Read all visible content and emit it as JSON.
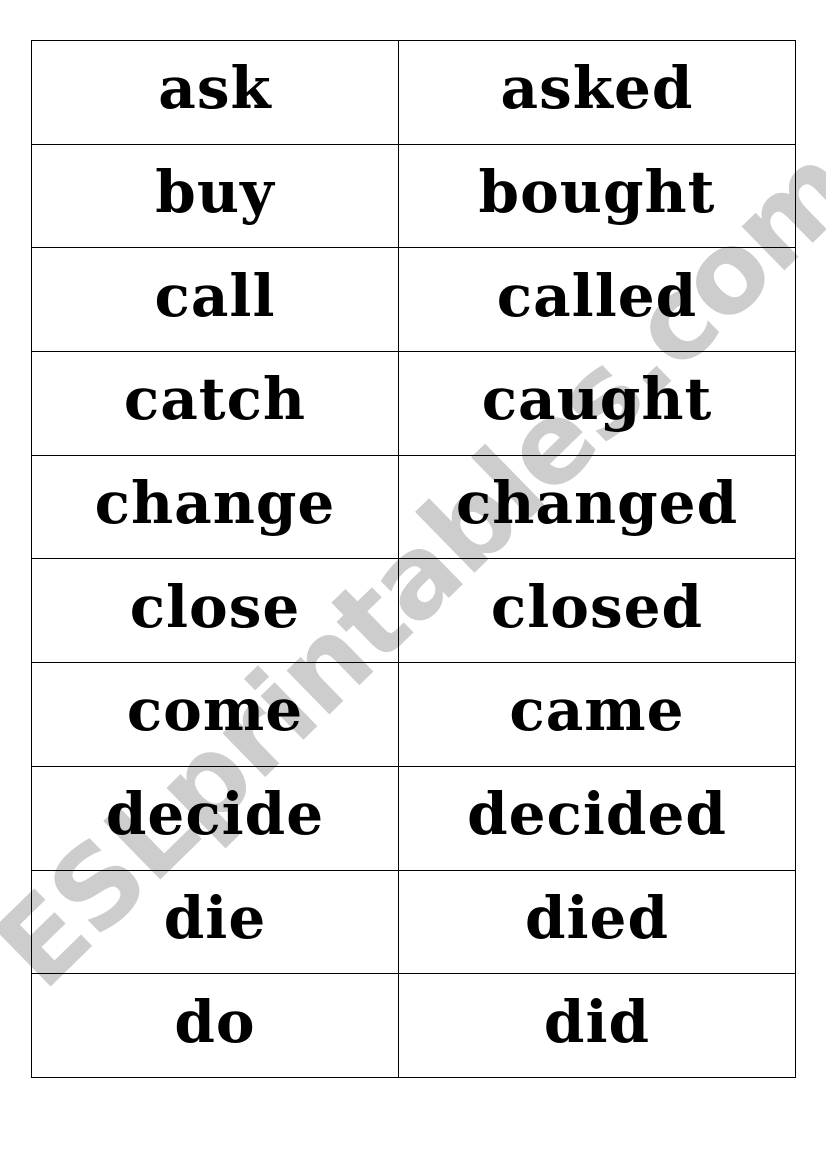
{
  "worksheet": {
    "columns": [
      "base_form",
      "past_form"
    ],
    "rows": [
      {
        "base": "ask",
        "past": "asked"
      },
      {
        "base": "buy",
        "past": "bought"
      },
      {
        "base": "call",
        "past": "called"
      },
      {
        "base": "catch",
        "past": "caught"
      },
      {
        "base": "change",
        "past": "changed"
      },
      {
        "base": "close",
        "past": "closed"
      },
      {
        "base": "come",
        "past": "came"
      },
      {
        "base": "decide",
        "past": "decided"
      },
      {
        "base": "die",
        "past": "died"
      },
      {
        "base": "do",
        "past": "did"
      }
    ]
  },
  "watermark": {
    "text": "ESLprintables.com",
    "color": "#c4c4c4"
  },
  "colors": {
    "text": "#000000",
    "border": "#000000",
    "background": "#ffffff"
  }
}
